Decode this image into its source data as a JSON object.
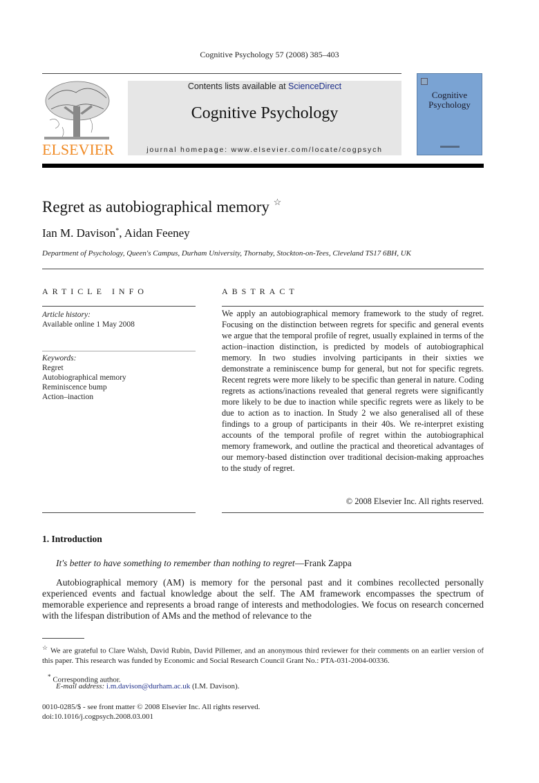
{
  "header": {
    "journal_reference": "Cognitive Psychology 57 (2008) 385–403",
    "publisher_wordmark": "ELSEVIER",
    "contents_prefix": "Contents lists available at ",
    "contents_link": "ScienceDirect",
    "journal_title": "Cognitive Psychology",
    "homepage": "journal homepage: www.elsevier.com/locate/cogpsych",
    "cover_title_line1": "Cognitive",
    "cover_title_line2": "Psychology"
  },
  "colors": {
    "publisher_orange": "#f08a24",
    "link_blue": "#1d2e8a",
    "cover_blue": "#7aa3d3",
    "banner_gray": "#e6e6e6"
  },
  "article": {
    "title": "Regret as autobiographical memory",
    "title_note_marker": "☆",
    "author1": "Ian M. Davison",
    "author1_marker": "*",
    "author_separator": ", ",
    "author2": "Aidan Feeney",
    "affiliation": "Department of Psychology, Queen's Campus, Durham University, Thornaby, Stockton-on-Tees, Cleveland TS17 6BH, UK"
  },
  "article_info": {
    "heading": "ARTICLE INFO",
    "history_label": "Article history:",
    "history_value": "Available online 1 May 2008",
    "keywords_label": "Keywords:",
    "keywords": [
      "Regret",
      "Autobiographical memory",
      "Reminiscence bump",
      "Action–inaction"
    ]
  },
  "abstract": {
    "heading": "ABSTRACT",
    "body": "We apply an autobiographical memory framework to the study of regret. Focusing on the distinction between regrets for specific and general events we argue that the temporal profile of regret, usually explained in terms of the action–inaction distinction, is predicted by models of autobiographical memory. In two studies involving participants in their sixties we demonstrate a reminiscence bump for general, but not for specific regrets. Recent regrets were more likely to be specific than general in nature. Coding regrets as actions/inactions revealed that general regrets were significantly more likely to be due to inaction while specific regrets were as likely to be due to action as to inaction. In Study 2 we also gener­alised all of these findings to a group of participants in their 40s. We re-interpret existing accounts of the temporal profile of regret within the autobiographical memory framework, and outline the practical and theoretical advantages of our memory-based distinc­tion over traditional decision-making approaches to the study of regret.",
    "copyright": "© 2008 Elsevier Inc. All rights reserved."
  },
  "introduction": {
    "heading": "1.  Introduction",
    "epigraph_quote": "It's better to have something to remember than nothing to regret",
    "epigraph_attribution": "—Frank Zappa",
    "paragraph": "Autobiographical memory (AM) is memory for the personal past and it combines recollected per­sonally experienced events and factual knowledge about the self. The AM framework encompasses the spectrum of memorable experience and represents a broad range of interests and methodologies. We focus on research concerned with the lifespan distribution of AMs and the method of relevance to the"
  },
  "footnotes": {
    "ack_marker": "☆",
    "ack_text": " We are grateful to Clare Walsh, David Rubin, David Pillemer, and an anonymous third reviewer for their comments on an earlier version of this paper. This research was funded by Economic and Social Research Council Grant No.: PTA-031-2004-00336.",
    "corr_marker": "*",
    "corr_text": " Corresponding author.",
    "email_label": "E-mail address: ",
    "email": "i.m.davison@durham.ac.uk",
    "email_suffix": " (I.M. Davison).",
    "issn_line": "0010-0285/$ - see front matter © 2008 Elsevier Inc. All rights reserved.",
    "doi_line": "doi:10.1016/j.cogpsych.2008.03.001"
  }
}
